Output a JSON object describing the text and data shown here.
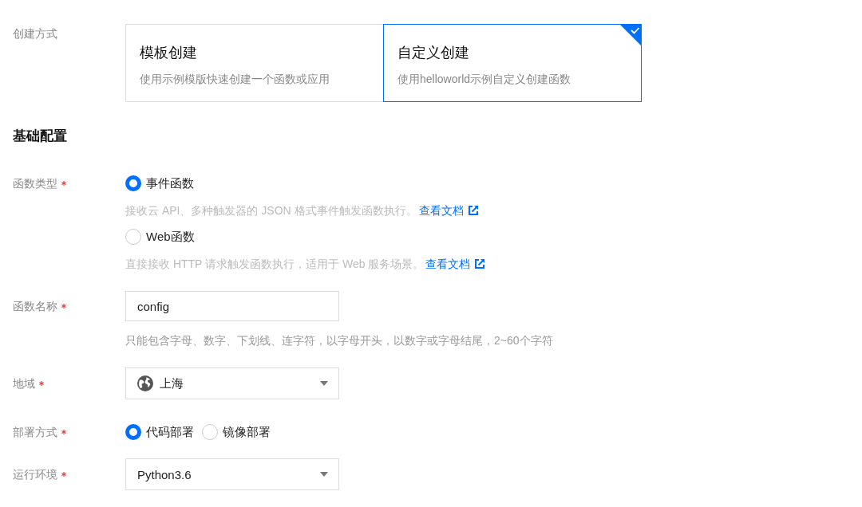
{
  "creation_method": {
    "label": "创建方式",
    "options": [
      {
        "title": "模板创建",
        "description": "使用示例模版快速创建一个函数或应用",
        "selected": false
      },
      {
        "title": "自定义创建",
        "description": "使用helloworld示例自定义创建函数",
        "selected": true
      }
    ]
  },
  "basic_config": {
    "heading": "基础配置",
    "fields": [
      {
        "kind": "radiolist",
        "label": "函数类型",
        "required": true,
        "options": [
          {
            "label": "事件函数",
            "selected": true,
            "description": "接收云 API、多种触发器的 JSON 格式事件触发函数执行。",
            "link": "查看文档"
          },
          {
            "label": "Web函数",
            "selected": false,
            "description": "直接接收 HTTP 请求触发函数执行，适用于 Web 服务场景。",
            "link": "查看文档"
          }
        ]
      },
      {
        "kind": "input",
        "label": "函数名称",
        "required": true,
        "value": "config",
        "hint": "只能包含字母、数字、下划线、连字符，以字母开头，以数字或字母结尾，2~60个字符"
      },
      {
        "kind": "region",
        "label": "地域",
        "required": true,
        "value": "上海"
      },
      {
        "kind": "radio",
        "label": "部署方式",
        "required": true,
        "options": [
          {
            "label": "代码部署",
            "selected": true
          },
          {
            "label": "镜像部署",
            "selected": false
          }
        ]
      },
      {
        "kind": "select",
        "label": "运行环境",
        "required": true,
        "value": "Python3.6"
      }
    ]
  }
}
